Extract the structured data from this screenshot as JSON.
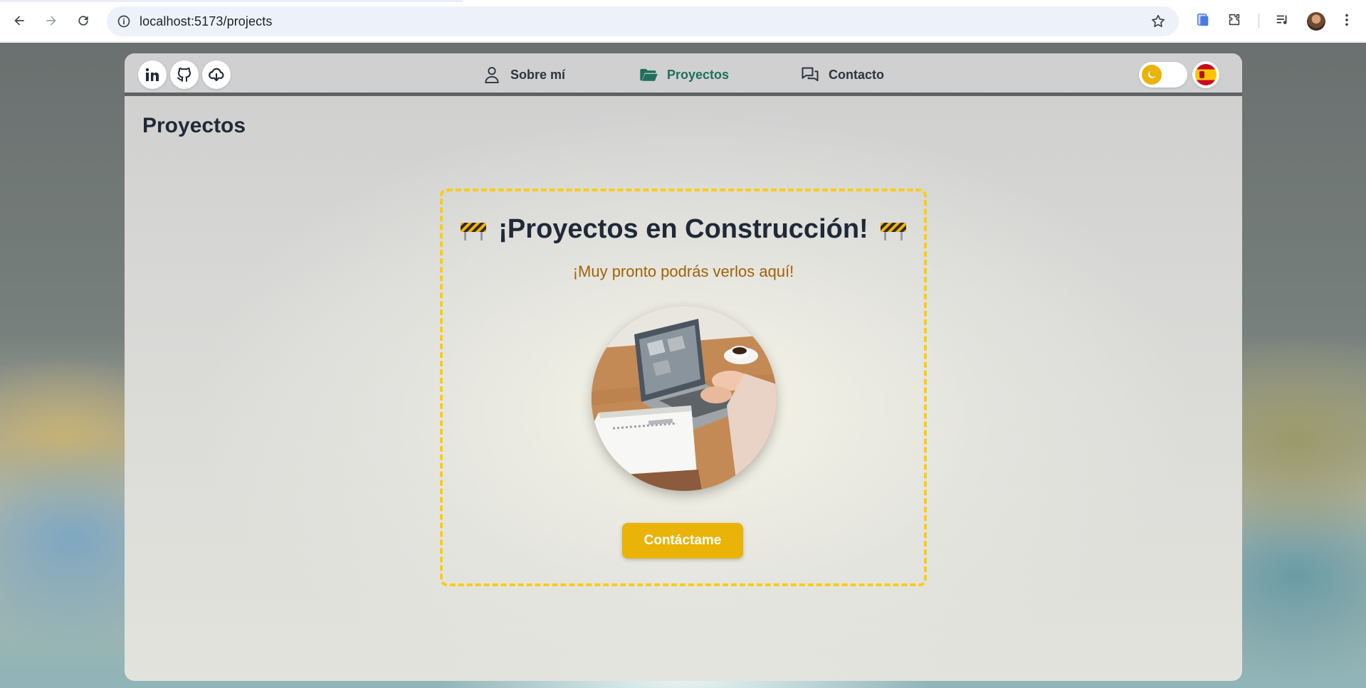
{
  "browser": {
    "url": "localhost:5173/projects"
  },
  "header": {
    "social": [
      {
        "name": "linkedin-icon"
      },
      {
        "name": "github-icon"
      },
      {
        "name": "cloud-download-icon"
      }
    ],
    "nav": [
      {
        "label": "Sobre mí",
        "icon": "user-icon"
      },
      {
        "label": "Proyectos",
        "icon": "folder-open-icon",
        "active": true
      },
      {
        "label": "Contacto",
        "icon": "chat-icon"
      }
    ],
    "theme_icon": "moon-icon",
    "language_icon": "spain-flag-icon"
  },
  "page": {
    "title": "Proyectos"
  },
  "construction": {
    "title": "¡Proyectos en Construcción!",
    "subtitle": "¡Muy pronto podrás verlos aquí!",
    "image_icon": "laptop-workspace-photo",
    "cta_label": "Contáctame"
  },
  "colors": {
    "accent": "#eab308",
    "active_nav": "#1f6f5c",
    "dashed_border": "#facc15",
    "subtitle": "#a16207"
  }
}
